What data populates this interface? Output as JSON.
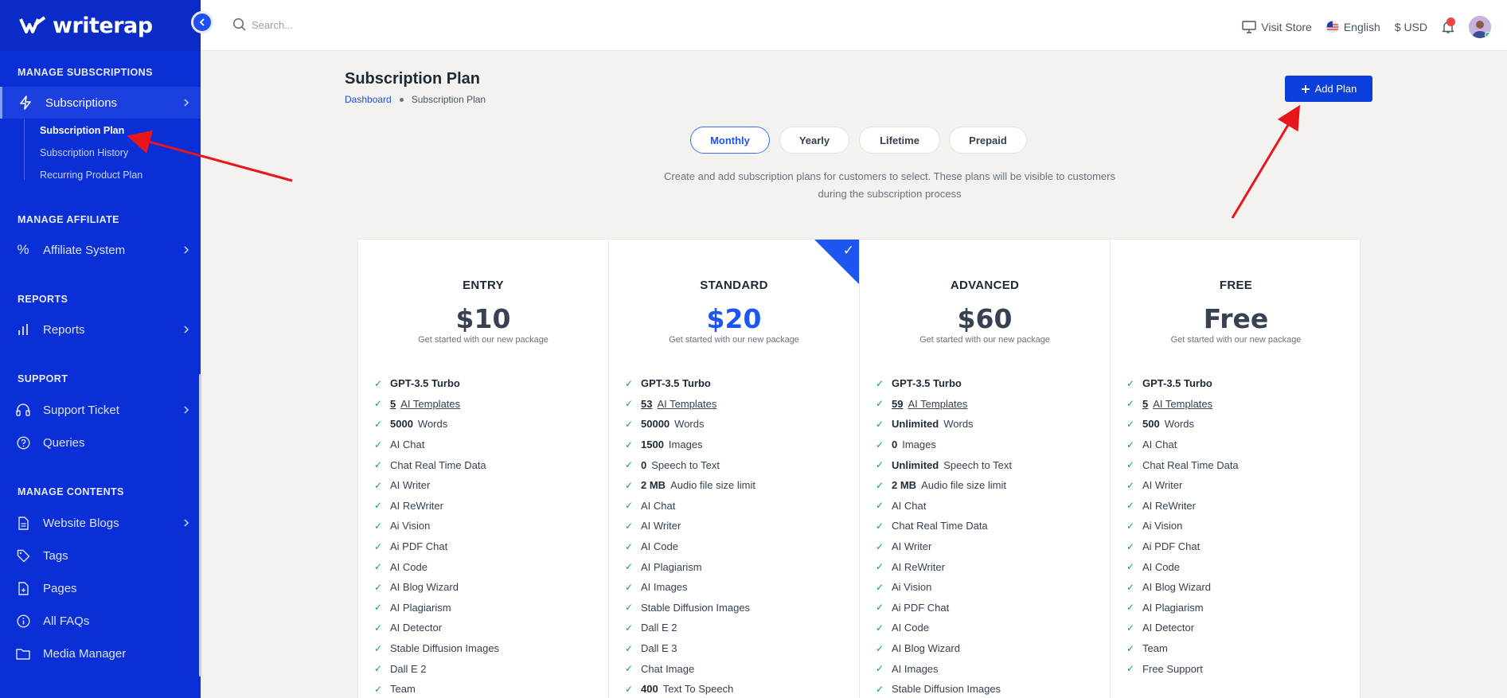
{
  "app": {
    "brand": "writerap"
  },
  "search": {
    "placeholder": "Search..."
  },
  "topbar": {
    "visit_store": "Visit Store",
    "language": "English",
    "currency": "$ USD"
  },
  "sidebar": {
    "sections": [
      {
        "title": "MANAGE SUBSCRIPTIONS"
      },
      {
        "title": "MANAGE AFFILIATE"
      },
      {
        "title": "REPORTS"
      },
      {
        "title": "SUPPORT"
      },
      {
        "title": "MANAGE CONTENTS"
      }
    ],
    "items": {
      "subscriptions": "Subscriptions",
      "affiliate": "Affiliate System",
      "reports": "Reports",
      "support_ticket": "Support Ticket",
      "queries": "Queries",
      "website_blogs": "Website Blogs",
      "tags": "Tags",
      "pages": "Pages",
      "faqs": "All FAQs",
      "media": "Media Manager"
    },
    "sub_items": [
      "Subscription Plan",
      "Subscription History",
      "Recurring Product Plan"
    ]
  },
  "main": {
    "title": "Subscription Plan",
    "breadcrumb": [
      "Dashboard",
      "Subscription Plan"
    ],
    "add_button": "Add Plan",
    "tabs": [
      "Monthly",
      "Yearly",
      "Lifetime",
      "Prepaid"
    ],
    "description_line1": "Create and add subscription plans for customers to select. These plans will be visible to customers",
    "description_line2": "during the subscription process"
  },
  "plans": [
    {
      "name": "ENTRY",
      "price": "$10",
      "tagline": "Get started with our new package",
      "features": [
        {
          "bold": "GPT-3.5 Turbo",
          "text": ""
        },
        {
          "bold": "5",
          "text": "AI Templates",
          "underline": true
        },
        {
          "bold": "5000",
          "text": "Words"
        },
        {
          "bold": "",
          "text": "AI Chat"
        },
        {
          "bold": "",
          "text": "Chat Real Time Data"
        },
        {
          "bold": "",
          "text": "AI Writer"
        },
        {
          "bold": "",
          "text": "AI ReWriter"
        },
        {
          "bold": "",
          "text": "Ai Vision"
        },
        {
          "bold": "",
          "text": "Ai PDF Chat"
        },
        {
          "bold": "",
          "text": "AI Code"
        },
        {
          "bold": "",
          "text": "AI Blog Wizard"
        },
        {
          "bold": "",
          "text": "AI Plagiarism"
        },
        {
          "bold": "",
          "text": "AI Detector"
        },
        {
          "bold": "",
          "text": "Stable Diffusion Images"
        },
        {
          "bold": "",
          "text": "Dall E 2"
        },
        {
          "bold": "",
          "text": "Team"
        }
      ]
    },
    {
      "name": "STANDARD",
      "price": "$20",
      "tagline": "Get started with our new package",
      "features": [
        {
          "bold": "GPT-3.5 Turbo",
          "text": ""
        },
        {
          "bold": "53",
          "text": "AI Templates",
          "underline": true
        },
        {
          "bold": "50000",
          "text": "Words"
        },
        {
          "bold": "1500",
          "text": "Images"
        },
        {
          "bold": "0",
          "text": "Speech to Text"
        },
        {
          "bold": "2 MB",
          "text": "Audio file size limit"
        },
        {
          "bold": "",
          "text": "AI Chat"
        },
        {
          "bold": "",
          "text": "AI Writer"
        },
        {
          "bold": "",
          "text": "AI Code"
        },
        {
          "bold": "",
          "text": "AI Plagiarism"
        },
        {
          "bold": "",
          "text": "AI Images"
        },
        {
          "bold": "",
          "text": "Stable Diffusion Images"
        },
        {
          "bold": "",
          "text": "Dall E 2"
        },
        {
          "bold": "",
          "text": "Dall E 3"
        },
        {
          "bold": "",
          "text": "Chat Image"
        },
        {
          "bold": "400",
          "text": "Text To Speech"
        }
      ]
    },
    {
      "name": "ADVANCED",
      "price": "$60",
      "tagline": "Get started with our new package",
      "features": [
        {
          "bold": "GPT-3.5 Turbo",
          "text": ""
        },
        {
          "bold": "59",
          "text": "AI Templates",
          "underline": true
        },
        {
          "bold": "Unlimited",
          "text": "Words"
        },
        {
          "bold": "0",
          "text": "Images"
        },
        {
          "bold": "Unlimited",
          "text": "Speech to Text"
        },
        {
          "bold": "2 MB",
          "text": "Audio file size limit"
        },
        {
          "bold": "",
          "text": "AI Chat"
        },
        {
          "bold": "",
          "text": "Chat Real Time Data"
        },
        {
          "bold": "",
          "text": "AI Writer"
        },
        {
          "bold": "",
          "text": "AI ReWriter"
        },
        {
          "bold": "",
          "text": "Ai Vision"
        },
        {
          "bold": "",
          "text": "Ai PDF Chat"
        },
        {
          "bold": "",
          "text": "AI Code"
        },
        {
          "bold": "",
          "text": "AI Blog Wizard"
        },
        {
          "bold": "",
          "text": "AI Images"
        },
        {
          "bold": "",
          "text": "Stable Diffusion Images"
        }
      ]
    },
    {
      "name": "FREE",
      "price": "Free",
      "tagline": "Get started with our new package",
      "features": [
        {
          "bold": "GPT-3.5 Turbo",
          "text": ""
        },
        {
          "bold": "5",
          "text": "AI Templates",
          "underline": true
        },
        {
          "bold": "500",
          "text": "Words"
        },
        {
          "bold": "",
          "text": "AI Chat"
        },
        {
          "bold": "",
          "text": "Chat Real Time Data"
        },
        {
          "bold": "",
          "text": "AI Writer"
        },
        {
          "bold": "",
          "text": "AI ReWriter"
        },
        {
          "bold": "",
          "text": "Ai Vision"
        },
        {
          "bold": "",
          "text": "Ai PDF Chat"
        },
        {
          "bold": "",
          "text": "AI Code"
        },
        {
          "bold": "",
          "text": "AI Blog Wizard"
        },
        {
          "bold": "",
          "text": "AI Plagiarism"
        },
        {
          "bold": "",
          "text": "AI Detector"
        },
        {
          "bold": "",
          "text": "Team"
        },
        {
          "bold": "",
          "text": "Free Support"
        }
      ]
    }
  ],
  "colors": {
    "sidebar": "#0a2fd6",
    "accent": "#1d55f0",
    "check": "#16a34a",
    "annotation": "#e8161b"
  }
}
